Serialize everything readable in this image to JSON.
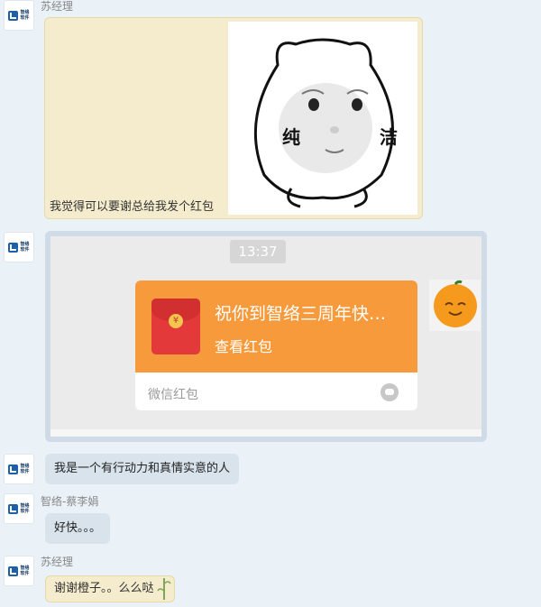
{
  "messages": [
    {
      "sender": "苏经理",
      "text": "我觉得可以要谢总给我发个红包",
      "sticker_text": [
        "纯",
        "洁"
      ]
    },
    {
      "screenshot": {
        "time": "13:37",
        "packet_title": "祝你到智络三周年快…",
        "packet_action": "查看红包",
        "packet_footer": "微信红包",
        "coin_symbol": "¥"
      }
    },
    {
      "text": "我是一个有行动力和真情实意的人"
    },
    {
      "sender": "智络-蔡李娟",
      "text": "好快。。。"
    },
    {
      "sender": "苏经理",
      "text": "谢谢橙子。。么么哒"
    }
  ],
  "avatar": {
    "logo_text_1": "智络",
    "logo_text_2": "软件"
  },
  "colors": {
    "background": "#eaf1f7",
    "bubble": "#d9e3ec",
    "packet": "#f79a3b",
    "red": "#e4393b"
  }
}
